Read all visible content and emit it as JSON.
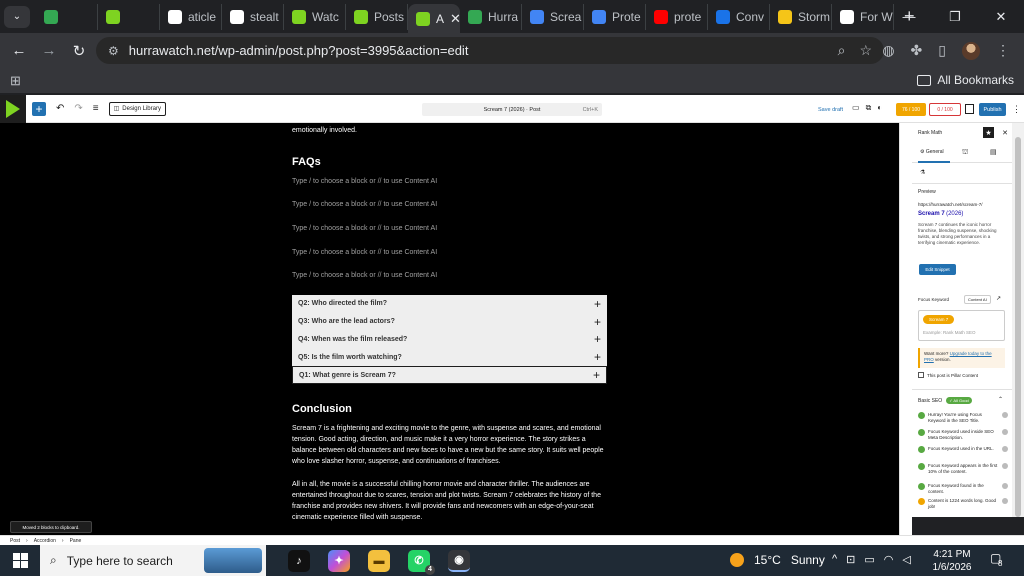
{
  "browser": {
    "tabs": [
      {
        "label": "",
        "icon": "green-plus-icon",
        "color": "#34a853"
      },
      {
        "label": "",
        "icon": "green-play-icon",
        "color": "#7ed321"
      },
      {
        "label": "aticle",
        "icon": "openai-icon",
        "color": "#ffffff"
      },
      {
        "label": "stealt",
        "icon": "openai-icon",
        "color": "#ffffff"
      },
      {
        "label": "Watc",
        "icon": "green-play-icon",
        "color": "#7ed321"
      },
      {
        "label": "Posts",
        "icon": "green-play-icon",
        "color": "#7ed321"
      },
      {
        "label": "A",
        "icon": "green-play-icon",
        "color": "#7ed321",
        "active": true
      },
      {
        "label": "Hurra",
        "icon": "green-plus-icon",
        "color": "#34a853"
      },
      {
        "label": "Screa",
        "icon": "docs-icon",
        "color": "#4285f4"
      },
      {
        "label": "Prote",
        "icon": "docs-icon",
        "color": "#4285f4"
      },
      {
        "label": "prote",
        "icon": "youtube-icon",
        "color": "#ff0000"
      },
      {
        "label": "Conv",
        "icon": "converter-icon",
        "color": "#1a73e8"
      },
      {
        "label": "Storm",
        "icon": "storm-icon",
        "color": "#f5c518"
      },
      {
        "label": "For W",
        "icon": "wikipedia-icon",
        "color": "#ffffff"
      }
    ],
    "url": "hurrawatch.net/wp-admin/post.php?post=3995&action=edit",
    "bookmarks_label": "All Bookmarks"
  },
  "editor": {
    "design_library": "Design Library",
    "doc_title": "Scream 7 (2026) · Post",
    "shortcut": "Ctrl+K",
    "save_draft": "Save draft",
    "seo_score": "76 / 100",
    "content_score": "0 / 100",
    "publish": "Publish"
  },
  "content": {
    "intro_tail": "emotionally involved.",
    "faqs_heading": "FAQs",
    "placeholder": "Type / to choose a block or // to use Content AI",
    "accordion": [
      "Q2: Who directed the film?",
      "Q3: Who are the lead actors?",
      "Q4: When was the film released?",
      "Q5: Is the film worth watching?",
      "Q1: What genre is Scream 7?"
    ],
    "conclusion_heading": "Conclusion",
    "conclusion_p1": "Scream 7 is a frightening and exciting movie to the genre, with suspense and scares, and emotional tension. Good acting, direction, and music make it a very horror experience. The story strikes a balance between old characters and new faces to have a new but the same story. It suits well people who love slasher horror, suspense, and continuations of franchises.",
    "conclusion_p2": "All in all, the movie is a successful chilling horror movie and character thriller. The audiences are entertained throughout due to scares, tension and plot twists. Scream 7 celebrates the history of the franchise and provides new shivers. It will provide fans and newcomers with an edge-of-your-seat cinematic experience filled with suspense.",
    "toast": "Moved 2 blocks to clipboard."
  },
  "sidebar": {
    "title": "Rank Math",
    "tab_general": "General",
    "preview_label": "Preview",
    "preview_url": "https://hurrawatch.net/scream-7/",
    "preview_title": "Scream 7",
    "preview_year": "(2026)",
    "preview_desc": "Scream 7 continues the iconic horror franchise, blending suspense, shocking twists, and strong performances in a terrifying cinematic experience.",
    "edit_snippet": "Edit Snippet",
    "focus_keyword": "Focus Keyword",
    "content_ai": "Content AI",
    "keyword": "Scream 7",
    "keyword_placeholder": "Example: Rank Math SEO",
    "upgrade_pre": "Want more?",
    "upgrade_link": "Upgrade today to the PRO",
    "upgrade_post": "version.",
    "pillar": "This post is Pillar Content",
    "basic_seo": "Basic SEO",
    "all_good": "✓ All Good",
    "checks": [
      {
        "text": "Hurray! You're using Focus Keyword in the SEO Title.",
        "status": "good"
      },
      {
        "text": "Focus Keyword used inside SEO Meta Description.",
        "status": "good"
      },
      {
        "text": "Focus Keyword used in the URL.",
        "status": "good"
      },
      {
        "text": "Focus Keyword appears in the first 10% of the content.",
        "status": "good"
      },
      {
        "text": "Focus Keyword found in the content.",
        "status": "good"
      },
      {
        "text": "Content is 1224 words long. Good job!",
        "status": "warn"
      }
    ]
  },
  "statusbar": {
    "crumbs": [
      "Post",
      "Accordion",
      "Pane"
    ]
  },
  "taskbar": {
    "search_placeholder": "Type here to search",
    "whatsapp_badge": "4",
    "temperature": "15°C",
    "weather": "Sunny",
    "time": "4:21 PM",
    "date": "1/6/2026",
    "notifications": "8"
  }
}
